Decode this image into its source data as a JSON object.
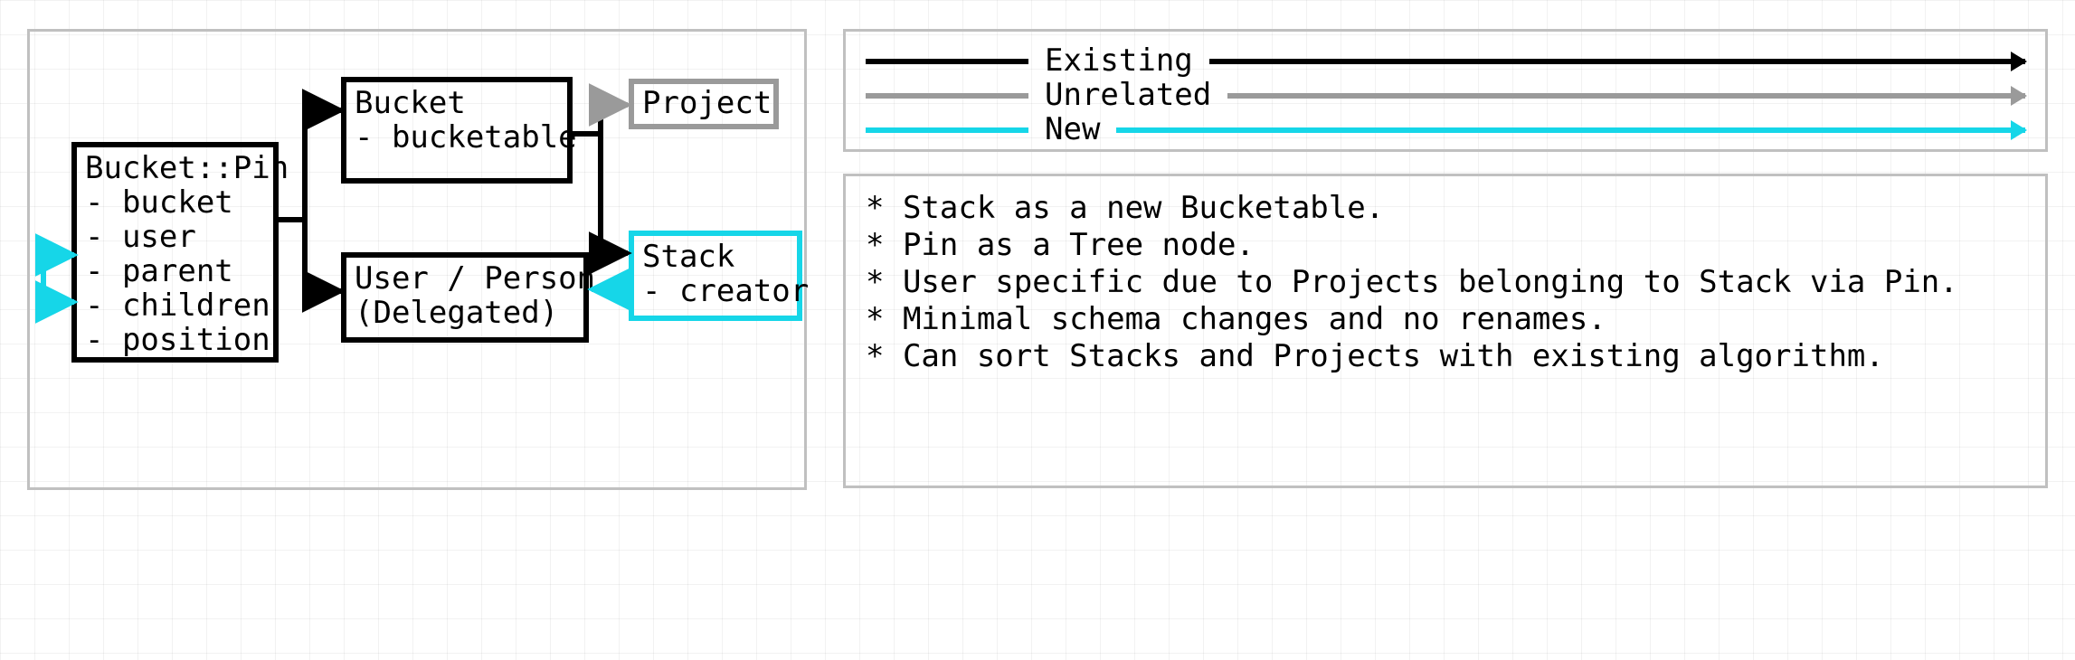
{
  "diagram": {
    "boxes": {
      "pin": {
        "title": "Bucket::Pin",
        "fields": [
          "- bucket",
          "- user",
          "- parent",
          "- children",
          "- position"
        ]
      },
      "bucket": {
        "title": "Bucket",
        "fields": [
          "- bucketable"
        ]
      },
      "user": {
        "title": "User / Person",
        "subtitle": "(Delegated)"
      },
      "project": {
        "title": "Project"
      },
      "stack": {
        "title": "Stack",
        "fields": [
          "- creator"
        ]
      }
    }
  },
  "legend": {
    "existing": "Existing",
    "unrelated": "Unrelated",
    "new": "New"
  },
  "notes": {
    "items": [
      "Stack as a new Bucketable.",
      "Pin as a Tree node.",
      "User specific due to Projects belonging to Stack via Pin.",
      "Minimal schema changes and no renames.",
      "Can sort Stacks and Projects with existing algorithm."
    ]
  },
  "colors": {
    "existing": "#000000",
    "unrelated": "#9a9a9a",
    "new": "#16d6e8",
    "panel_border": "#c0c0c0"
  }
}
